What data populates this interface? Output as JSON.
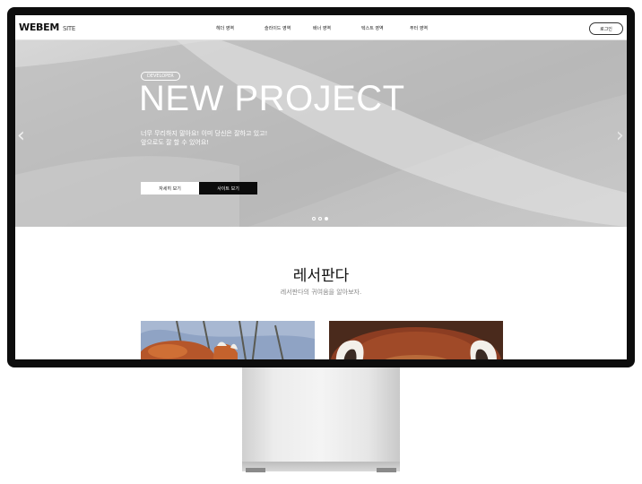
{
  "header": {
    "logo": "WEBEM",
    "logo_sub": "SITE",
    "nav": [
      "헤더 영역",
      "슬라이드 영역",
      "배너 영역",
      "텍스트 영역",
      "푸터 영역"
    ],
    "login_label": "로그인"
  },
  "hero": {
    "badge": "DEVELOPER",
    "title": "NEW PROJECT",
    "desc_line1": "너무 무리하지 말아요! 이미 당신은 잘하고 있고!",
    "desc_line2": "앞으로도 잘 할 수 있어요!",
    "btn_details": "자세히 보기",
    "btn_site": "사이트 보기",
    "prev_icon": "‹",
    "next_icon": "›",
    "slide_count": 3,
    "active_slide": 3
  },
  "section": {
    "title": "레서판다",
    "subtitle": "레서판다의 귀여움을 알아보자."
  },
  "colors": {
    "accent_dark": "#0b0b0b",
    "hero_bg": "#c4c4c4"
  }
}
